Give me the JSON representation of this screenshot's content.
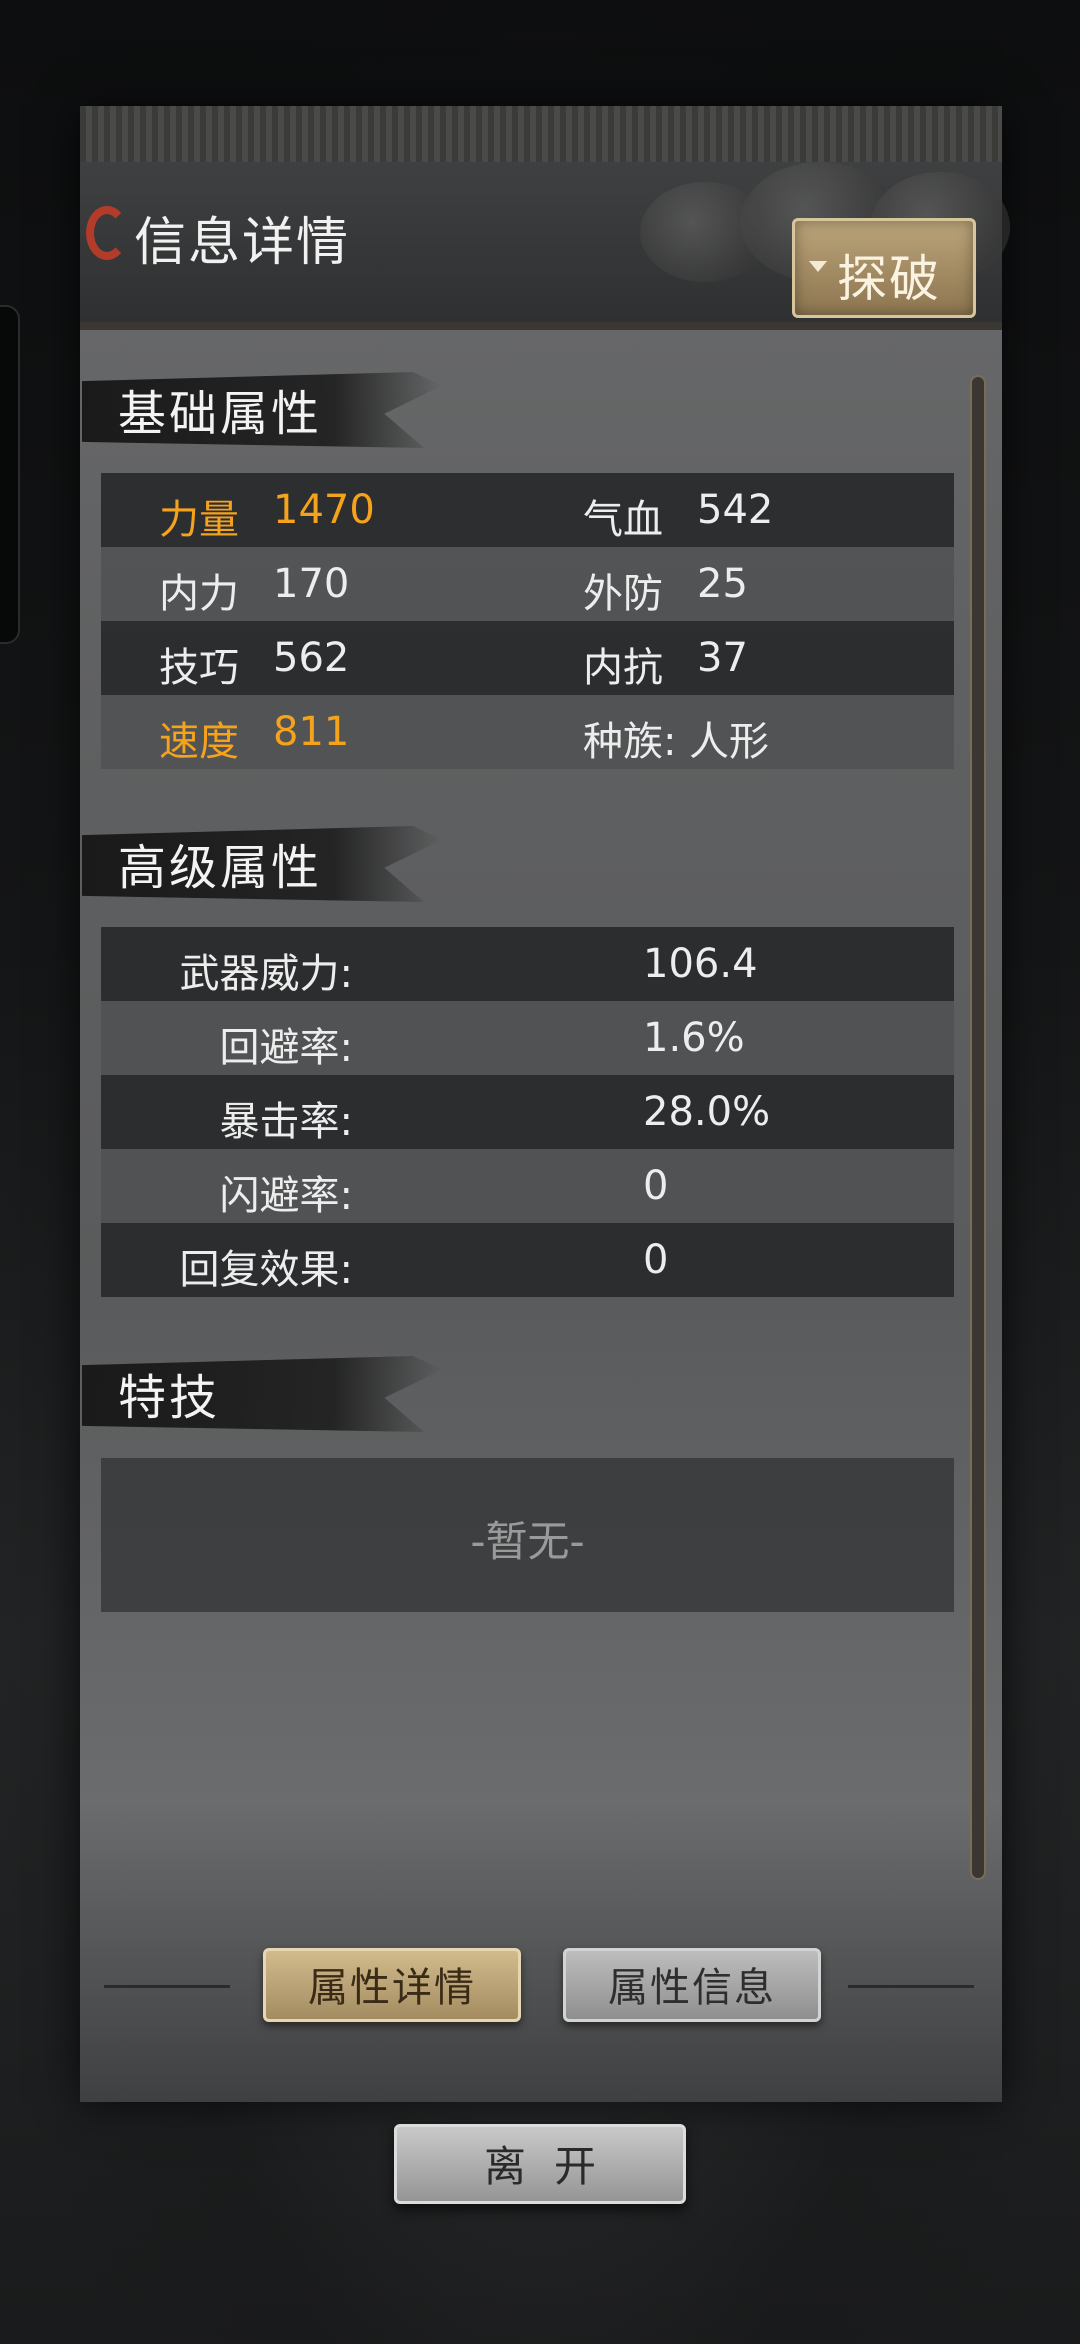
{
  "header": {
    "title": "信息详情",
    "dropdown_label": "探破"
  },
  "basic": {
    "title": "基础属性",
    "rows": [
      {
        "l_label": "力量",
        "l_value": "1470",
        "r_label": "气血",
        "r_value": "542",
        "highlight": true
      },
      {
        "l_label": "内力",
        "l_value": "170",
        "r_label": "外防",
        "r_value": "25",
        "highlight": false
      },
      {
        "l_label": "技巧",
        "l_value": "562",
        "r_label": "内抗",
        "r_value": "37",
        "highlight": false
      },
      {
        "l_label": "速度",
        "l_value": "811",
        "r_label": "种族:",
        "r_value": "人形",
        "highlight": true
      }
    ]
  },
  "advanced": {
    "title": "高级属性",
    "rows": [
      {
        "label": "武器威力:",
        "value": "106.4"
      },
      {
        "label": "回避率:",
        "value": "1.6%"
      },
      {
        "label": "暴击率:",
        "value": "28.0%"
      },
      {
        "label": "闪避率:",
        "value": "0"
      },
      {
        "label": "回复效果:",
        "value": "0"
      }
    ]
  },
  "skills": {
    "title": "特技",
    "empty_text": "-暂无-"
  },
  "tabs": [
    {
      "label": "属性详情",
      "active": true
    },
    {
      "label": "属性信息",
      "active": false
    }
  ],
  "leave_label": "离开",
  "colors": {
    "highlight": "#f5a21c",
    "accent_gold": "#bba47a"
  }
}
